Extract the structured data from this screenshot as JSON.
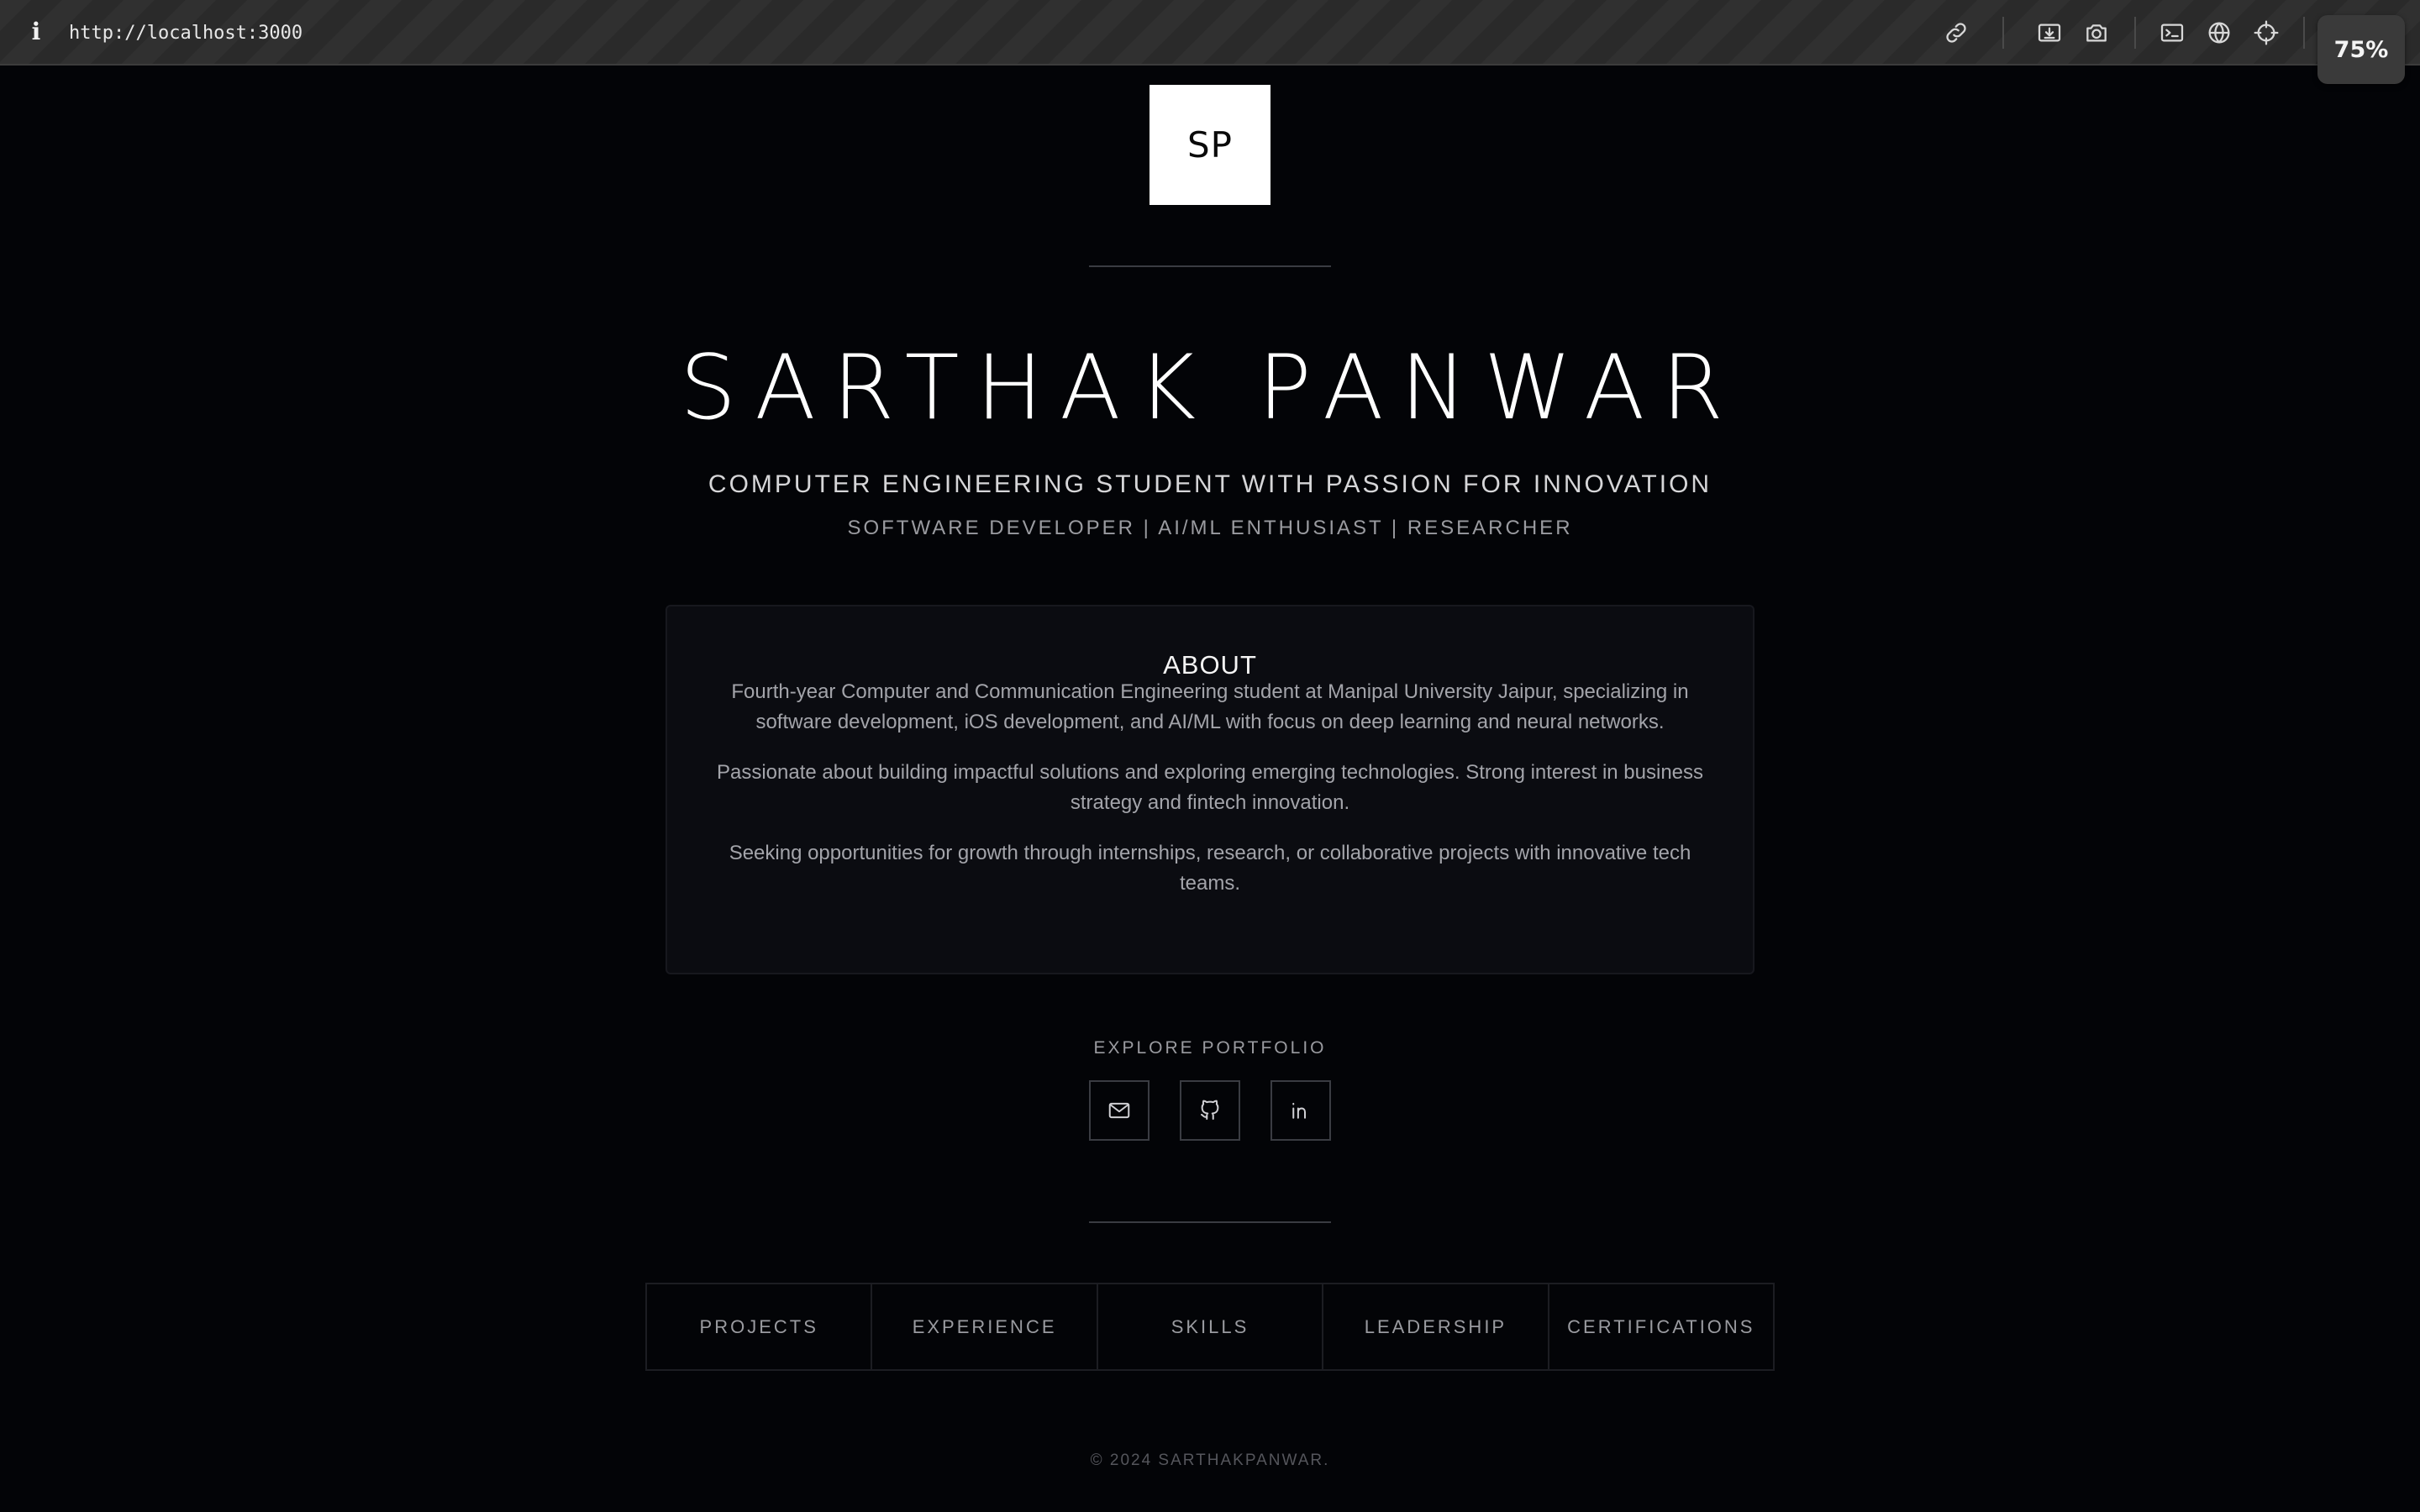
{
  "browser": {
    "url": "http://localhost:3000",
    "info_glyph": "i",
    "zoom": "75%",
    "icons": [
      "link-icon",
      "download-icon",
      "camera-icon",
      "terminal-icon",
      "globe-icon",
      "crosshair-icon"
    ]
  },
  "hero": {
    "monogram": "SP",
    "name": "SARTHAK PANWAR",
    "tagline": "COMPUTER ENGINEERING STUDENT WITH PASSION FOR INNOVATION",
    "roles": "SOFTWARE DEVELOPER | AI/ML ENTHUSIAST | RESEARCHER"
  },
  "about": {
    "title": "ABOUT",
    "paragraphs": [
      "Fourth-year Computer and Communication Engineering student at Manipal University Jaipur, specializing in software development, iOS development, and AI/ML with focus on deep learning and neural networks.",
      "Passionate about building impactful solutions and exploring emerging technologies. Strong interest in business strategy and fintech innovation.",
      "Seeking opportunities for growth through internships, research, or collaborative projects with innovative tech teams."
    ]
  },
  "explore": {
    "label": "EXPLORE PORTFOLIO",
    "links": [
      "mail-icon",
      "github-icon",
      "linkedin-icon"
    ]
  },
  "nav": [
    "PROJECTS",
    "EXPERIENCE",
    "SKILLS",
    "LEADERSHIP",
    "CERTIFICATIONS"
  ],
  "footer": "© 2024 SARTHAKPANWAR.",
  "colors": {
    "background": "#030407",
    "card": "#0b0c11",
    "text_primary": "#ffffff",
    "text_muted": "#9a9ba0"
  }
}
